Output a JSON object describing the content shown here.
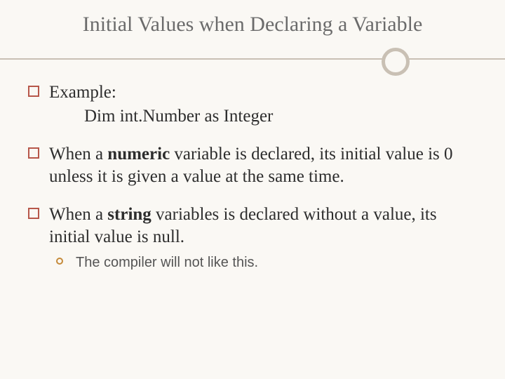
{
  "title": "Initial Values when Declaring a Variable",
  "items": [
    {
      "lead": "Example:",
      "indent": "Dim int.Number as Integer"
    },
    {
      "pre": "When a ",
      "bold": "numeric",
      "post": " variable is declared,  its initial value is 0 unless it is given a value at the same time."
    },
    {
      "pre": "When a ",
      "bold": "string",
      "post": " variables is declared without a value, its initial value is null.",
      "sub": "The compiler will not like this."
    }
  ]
}
